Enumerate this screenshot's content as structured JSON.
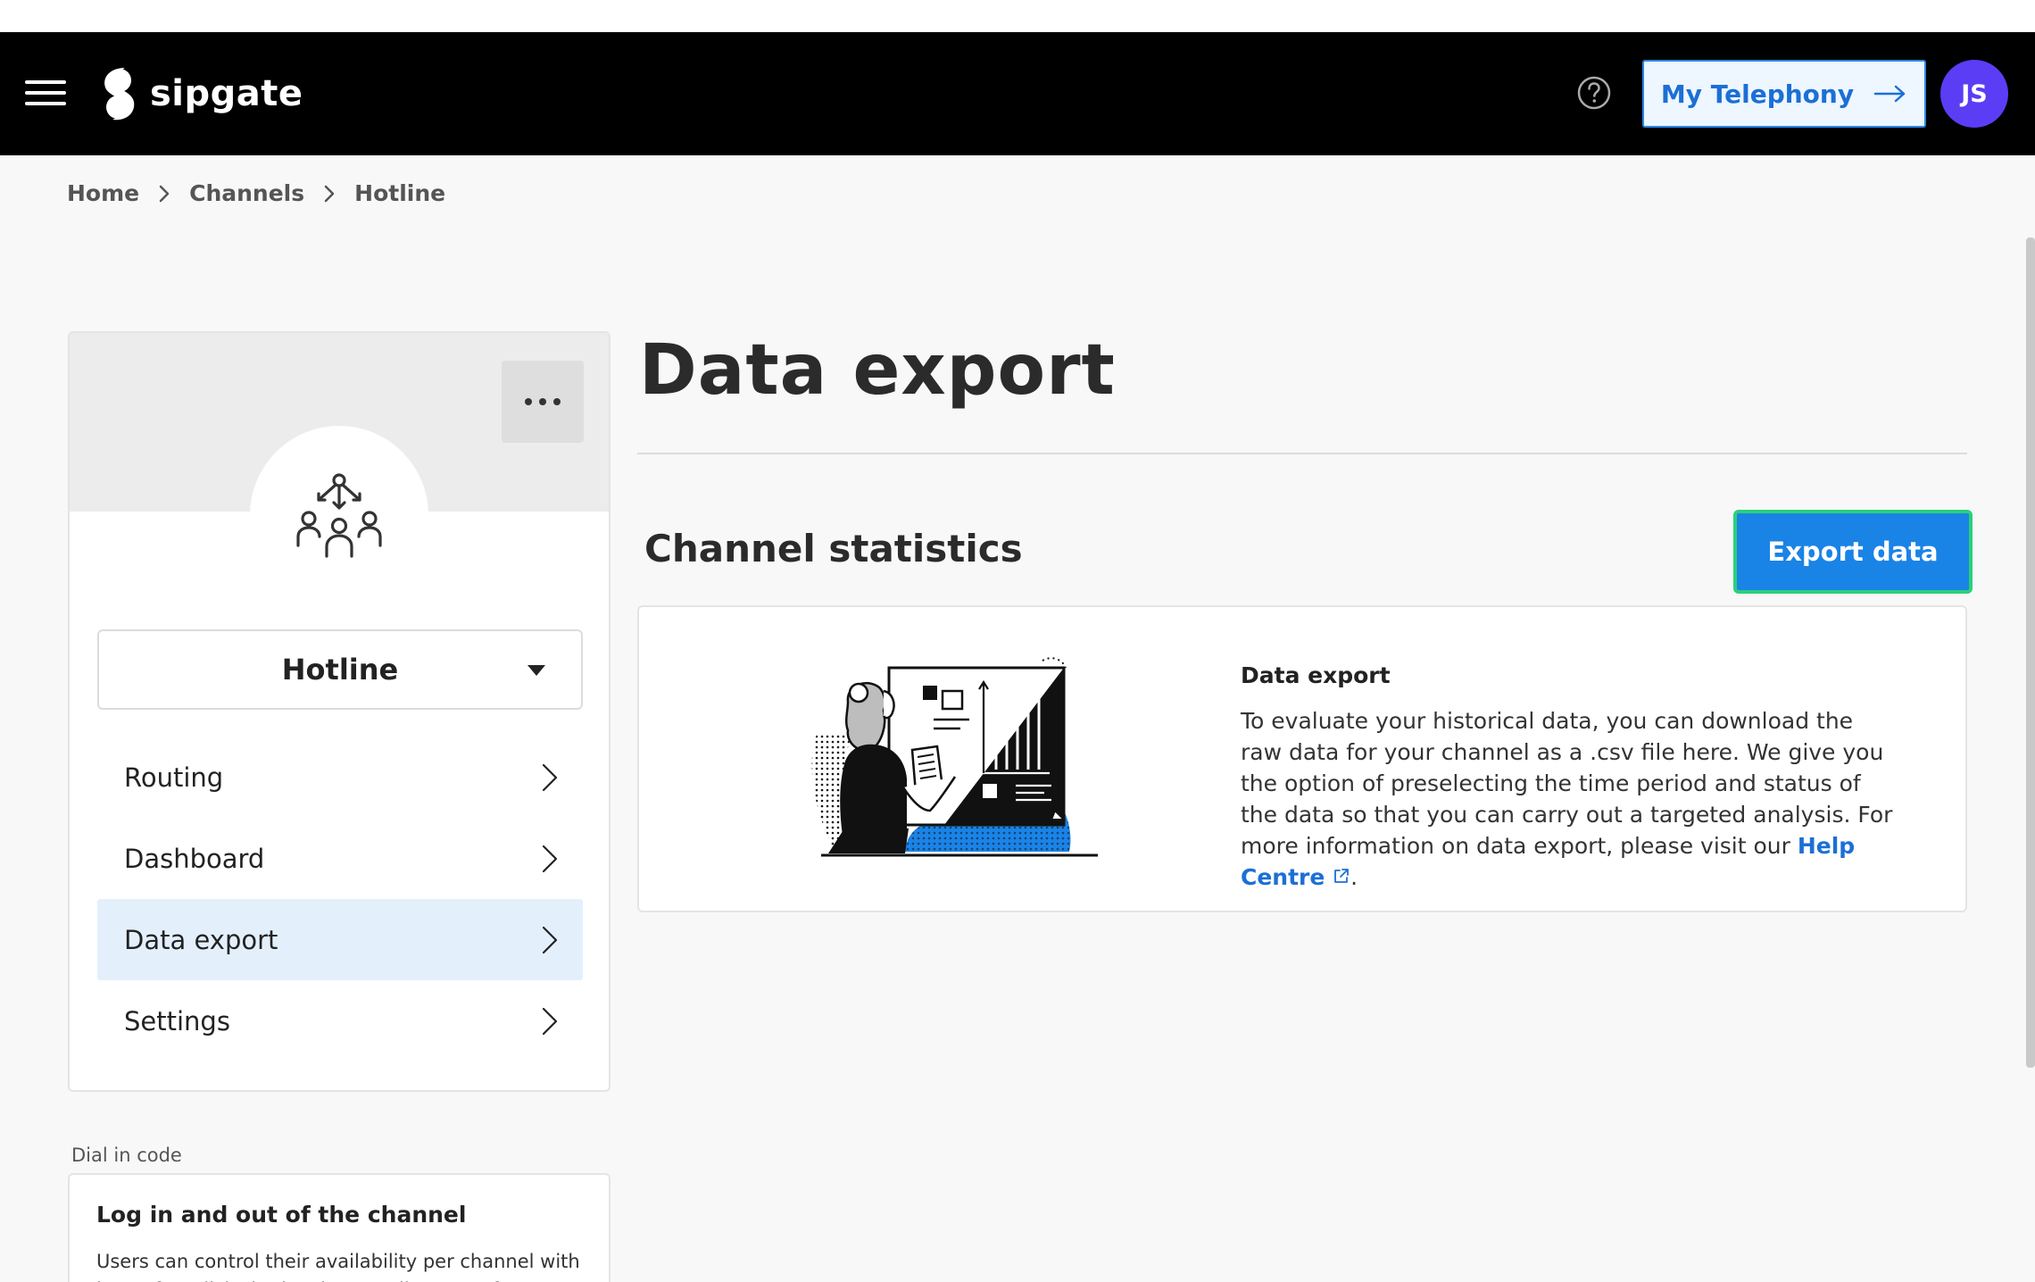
{
  "header": {
    "logo_text": "sipgate",
    "my_telephony_label": "My Telephony",
    "avatar_initials": "JS"
  },
  "breadcrumb": {
    "items": [
      "Home",
      "Channels",
      "Hotline"
    ]
  },
  "sidebar": {
    "channel_name": "Hotline",
    "nav_items": [
      {
        "label": "Routing"
      },
      {
        "label": "Dashboard"
      },
      {
        "label": "Data export"
      },
      {
        "label": "Settings"
      }
    ],
    "active_item": "Data export",
    "dial_in": {
      "label": "Dial in code",
      "title": "Log in and out of the channel",
      "text": "Users can control their availability per channel with just a few clicks in the sipgate Clinq app. If your"
    }
  },
  "main": {
    "page_title": "Data export",
    "section_title": "Channel statistics",
    "export_button_label": "Export data",
    "card": {
      "heading": "Data export",
      "body": "To evaluate your historical data, you can download the raw data for your channel as a .csv file here. We give you the option of preselecting the time period and status of the data so that you can carry out a targeted analysis. For more information on data export, please visit our ",
      "link_text": "Help Centre",
      "body_end": "."
    }
  },
  "colors": {
    "accent_blue": "#1a83e6",
    "focus_green": "#2ad07a",
    "avatar_purple": "#5b3df5",
    "active_nav_bg": "#e3f0fc"
  }
}
